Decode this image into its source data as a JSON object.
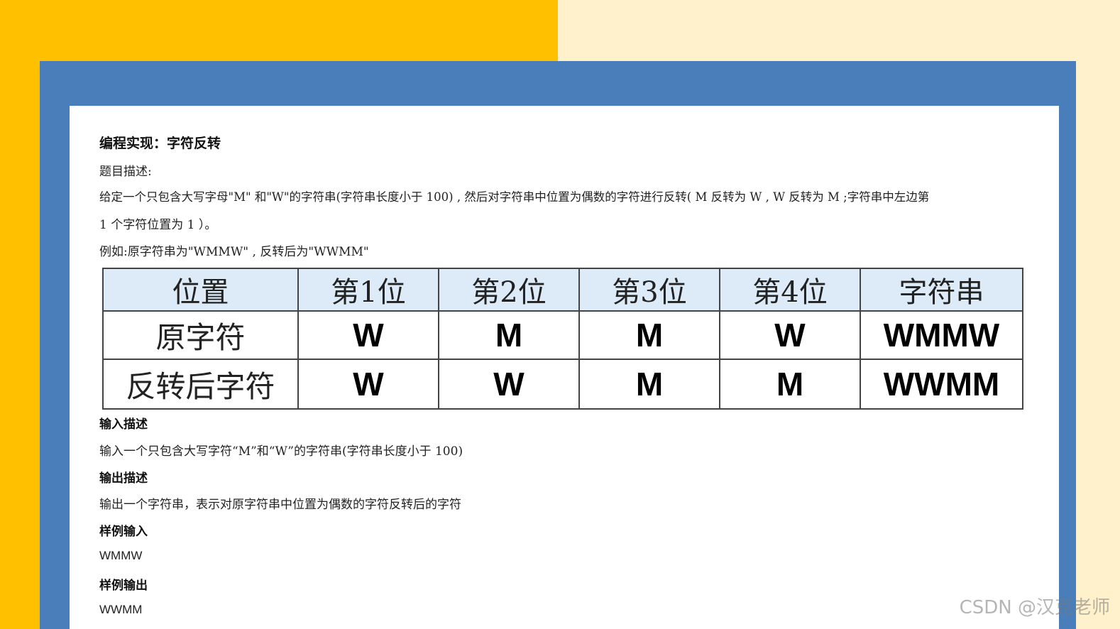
{
  "doc": {
    "title": "编程实现：字符反转",
    "desc_label": "题目描述:",
    "desc_line1": "给定一个只包含大写字母\"M\" 和\"W\"的字符串(字符串长度小于  100) , 然后对字符串中位置为偶数的字符进行反转( M 反转为  W , W 反转为  M ;字符串中左边第",
    "desc_line2": "1 个字符位置为  1 ）。",
    "example": "例如:原字符串为\"WMMW\" , 反转后为\"WWMM\"",
    "input_title": "输入描述",
    "input_text": "输入一个只包含大写字符“M”和“W”的字符串(字符串长度小于  100)",
    "output_title": "输出描述",
    "output_text": "输出一个字符串，表示对原字符串中位置为偶数的字符反转后的字符",
    "sample_in_title": "样例输入",
    "sample_in": "WMMW",
    "sample_out_title": "样例输出",
    "sample_out": "WWMM"
  },
  "table": {
    "headers": [
      "位置",
      "第1位",
      "第2位",
      "第3位",
      "第4位",
      "字符串"
    ],
    "rows": [
      [
        "原字符",
        "W",
        "M",
        "M",
        "W",
        "WMMW"
      ],
      [
        "反转后字符",
        "W",
        "W",
        "M",
        "M",
        "WWMM"
      ]
    ]
  },
  "watermark": "CSDN @汉克老师",
  "colors": {
    "left_bg": "#ffc000",
    "right_bg": "#fff1cc",
    "frame": "#4a7ebb",
    "header_fill": "#dcebf7"
  }
}
